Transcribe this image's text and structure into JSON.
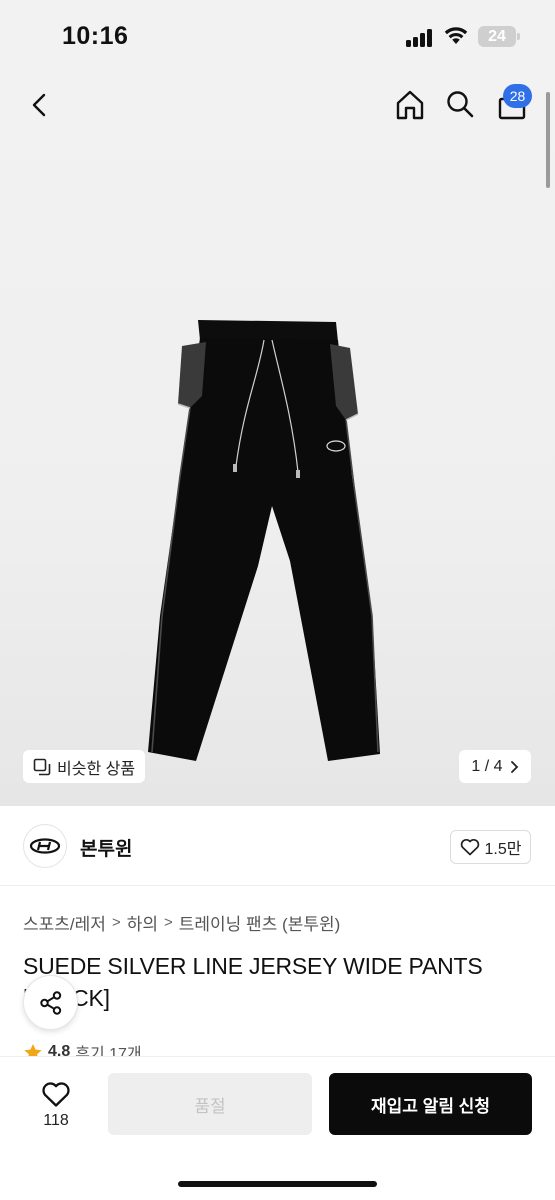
{
  "status_bar": {
    "time": "10:16",
    "battery": "24"
  },
  "nav": {
    "back_icon": "chevron-left-icon",
    "home_icon": "home-icon",
    "search_icon": "search-icon",
    "bag_icon": "shopping-bag-icon",
    "bag_badge": "28",
    "badge_color": "#2f6fe8"
  },
  "gallery": {
    "similar_label": "비슷한 상품",
    "page_indicator": "1 / 4",
    "current_page": 1,
    "total_pages": 4
  },
  "brand": {
    "name": "본투윈",
    "like_count": "1.5만"
  },
  "breadcrumb": {
    "items": [
      "스포츠/레저",
      "하의",
      "트레이닝 팬츠 (본투윈)"
    ]
  },
  "product": {
    "title": "SUEDE SILVER LINE JERSEY WIDE PANTS [BLACK]",
    "rating": "4.8",
    "review_text": "후기 17개",
    "star_color": "#f0a818"
  },
  "bottom_bar": {
    "wish_count": "118",
    "soldout_label": "품절",
    "restock_label": "재입고 알림 신청"
  }
}
